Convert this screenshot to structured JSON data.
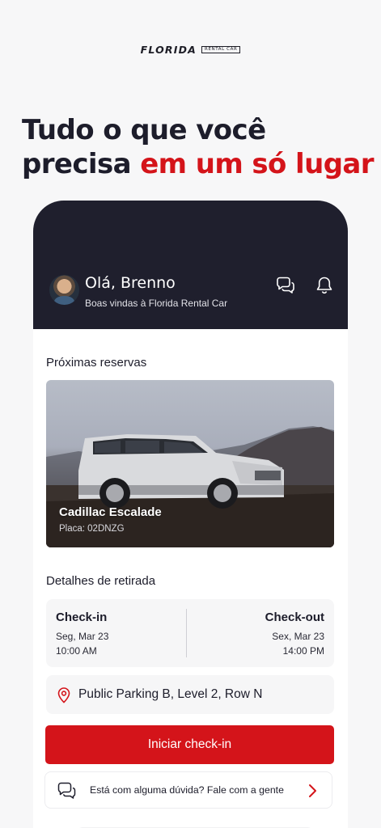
{
  "brand": {
    "name": "FLORIDA",
    "tag": "RENTAL CAR"
  },
  "hero": {
    "line1": "Tudo o que você",
    "line2_plain": "precisa ",
    "line2_accent": "em um só lugar"
  },
  "header": {
    "greeting": "Olá, Brenno",
    "subtitle": "Boas vindas à Florida Rental Car",
    "icons": [
      "chat-icon",
      "bell-icon"
    ]
  },
  "reservations": {
    "title": "Próximas reservas",
    "car_name": "Cadillac Escalade",
    "plate": "Placa: 02DNZG"
  },
  "pickup": {
    "title": "Detalhes de retirada",
    "checkin": {
      "label": "Check-in",
      "date": "Seg, Mar 23",
      "time": "10:00 AM"
    },
    "checkout": {
      "label": "Check-out",
      "date": "Sex, Mar 23",
      "time": "14:00 PM"
    },
    "location": "Public Parking B, Level 2, Row N"
  },
  "actions": {
    "primary": "Iniciar check-in",
    "help": "Está com alguma dúvida? Fale com a gente"
  },
  "colors": {
    "accent": "#d4141a",
    "dark": "#1f1f2d"
  }
}
